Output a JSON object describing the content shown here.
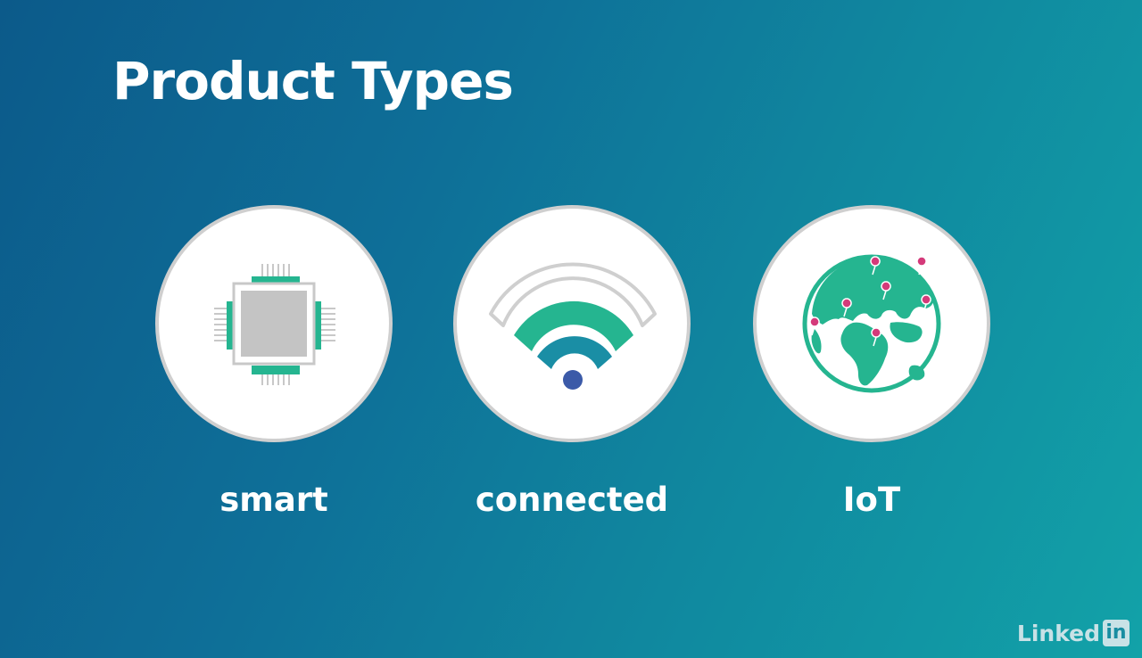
{
  "slide": {
    "title": "Product Types"
  },
  "items": [
    {
      "label": "smart",
      "icon": "chip-icon"
    },
    {
      "label": "connected",
      "icon": "wifi-icon"
    },
    {
      "label": "IoT",
      "icon": "globe-icon"
    }
  ],
  "logo": {
    "text": "Linked",
    "box": "in"
  },
  "colors": {
    "background_start": "#0c5a8a",
    "background_end": "#12a2a8",
    "accent_green": "#25b590",
    "teal": "#1a8ea5",
    "pin": "#d43a7a",
    "wifi_dot": "#3b5aa8",
    "chip_gray": "#c4c4c4"
  }
}
